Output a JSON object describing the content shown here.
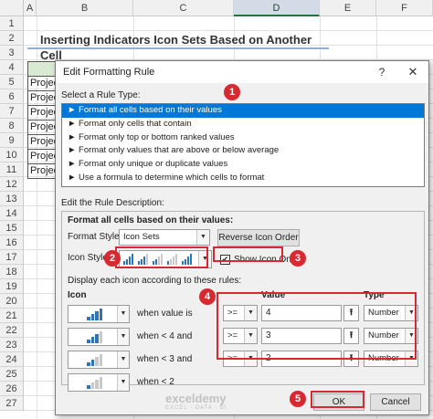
{
  "sheet": {
    "columns": [
      "A",
      "B",
      "C",
      "D",
      "E",
      "F"
    ],
    "selected_column": "D",
    "rows": [
      "1",
      "2",
      "3",
      "4",
      "5",
      "6",
      "7",
      "8",
      "9",
      "10",
      "11",
      "12",
      "13",
      "14",
      "15",
      "16",
      "17",
      "18",
      "19",
      "20",
      "21",
      "22",
      "23",
      "24",
      "25",
      "26",
      "27"
    ],
    "title": "Inserting Indicators Icon Sets Based on Another Cell",
    "project_cells": [
      "Projec",
      "Projec",
      "Projec",
      "Projec",
      "Projec",
      "Projec",
      "Projec"
    ]
  },
  "dialog": {
    "title": "Edit Formatting Rule",
    "help": "?",
    "close": "✕",
    "rule_type_label": "Select a Rule Type:",
    "rule_types": [
      "► Format all cells based on their values",
      "► Format only cells that contain",
      "► Format only top or bottom ranked values",
      "► Format only values that are above or below average",
      "► Format only unique or duplicate values",
      "► Use a formula to determine which cells to format"
    ],
    "selected_rule_index": 0,
    "edit_label": "Edit the Rule Description:",
    "desc_heading": "Format all cells based on their values:",
    "format_style_label": "Format Style:",
    "format_style_value": "Icon Sets",
    "reverse_label": "Reverse Icon Order",
    "icon_style_label": "Icon Style:",
    "show_icon_only_label": "Show Icon Only",
    "show_icon_only_checked": true,
    "display_rules_label": "Display each icon according to these rules:",
    "col_icon": "Icon",
    "col_value": "Value",
    "col_type": "Type",
    "icon_rules": [
      {
        "condition": "when value is",
        "op": ">=",
        "value": "4",
        "type": "Number",
        "bars_filled": 4
      },
      {
        "condition": "when < 4 and",
        "op": ">=",
        "value": "3",
        "type": "Number",
        "bars_filled": 3
      },
      {
        "condition": "when < 3 and",
        "op": ">=",
        "value": "2",
        "type": "Number",
        "bars_filled": 2
      },
      {
        "condition": "when < 2",
        "op": "",
        "value": "",
        "type": "",
        "bars_filled": 1
      }
    ],
    "ok": "OK",
    "cancel": "Cancel"
  },
  "annotations": [
    "1",
    "2",
    "3",
    "4",
    "5"
  ],
  "watermark": {
    "name": "exceldemy",
    "tagline": "EXCEL · DATA · BI"
  },
  "colors": {
    "accent": "#0078d7",
    "annotation": "#d9282f",
    "bar_filled": "#2e75b6",
    "bar_empty": "#c9c9c9"
  }
}
